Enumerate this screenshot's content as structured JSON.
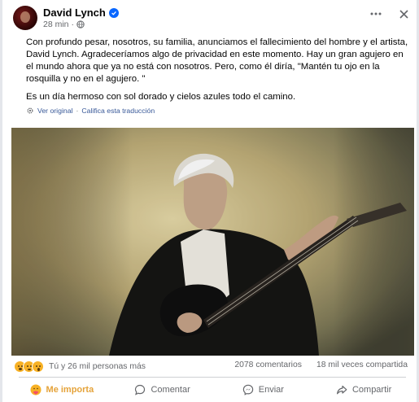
{
  "post": {
    "author": "David Lynch",
    "time": "28 min",
    "separator": "·",
    "paragraphs": [
      "Con profundo pesar, nosotros, su familia, anunciamos el fallecimiento del hombre y el artista, David Lynch. Agradeceríamos algo de privacidad en este momento. Hay un gran agujero en el mundo ahora que ya no está con nosotros. Pero, como él diría, \"Mantén tu ojo en la rosquilla y no en el agujero. \"",
      "Es un día hermoso con sol dorado y cielos azules todo el camino."
    ],
    "translation": {
      "see_original": "Ver original",
      "dot": "·",
      "rate": "Califica esta traducción"
    }
  },
  "stats": {
    "reactions_text": "Tú y 26 mil personas más",
    "comments": "2078 comentarios",
    "shares": "18 mil veces compartida"
  },
  "actions": {
    "react": "Me importa",
    "comment": "Comentar",
    "send": "Enviar",
    "share": "Compartir"
  },
  "icons": {
    "verified": "verified-badge-icon",
    "globe": "globe-icon",
    "more": "more-options-icon",
    "close": "close-icon",
    "gear": "translation-gear-icon"
  },
  "colors": {
    "link": "#385898",
    "verified": "#0866ff",
    "care": "#e5a33a"
  }
}
